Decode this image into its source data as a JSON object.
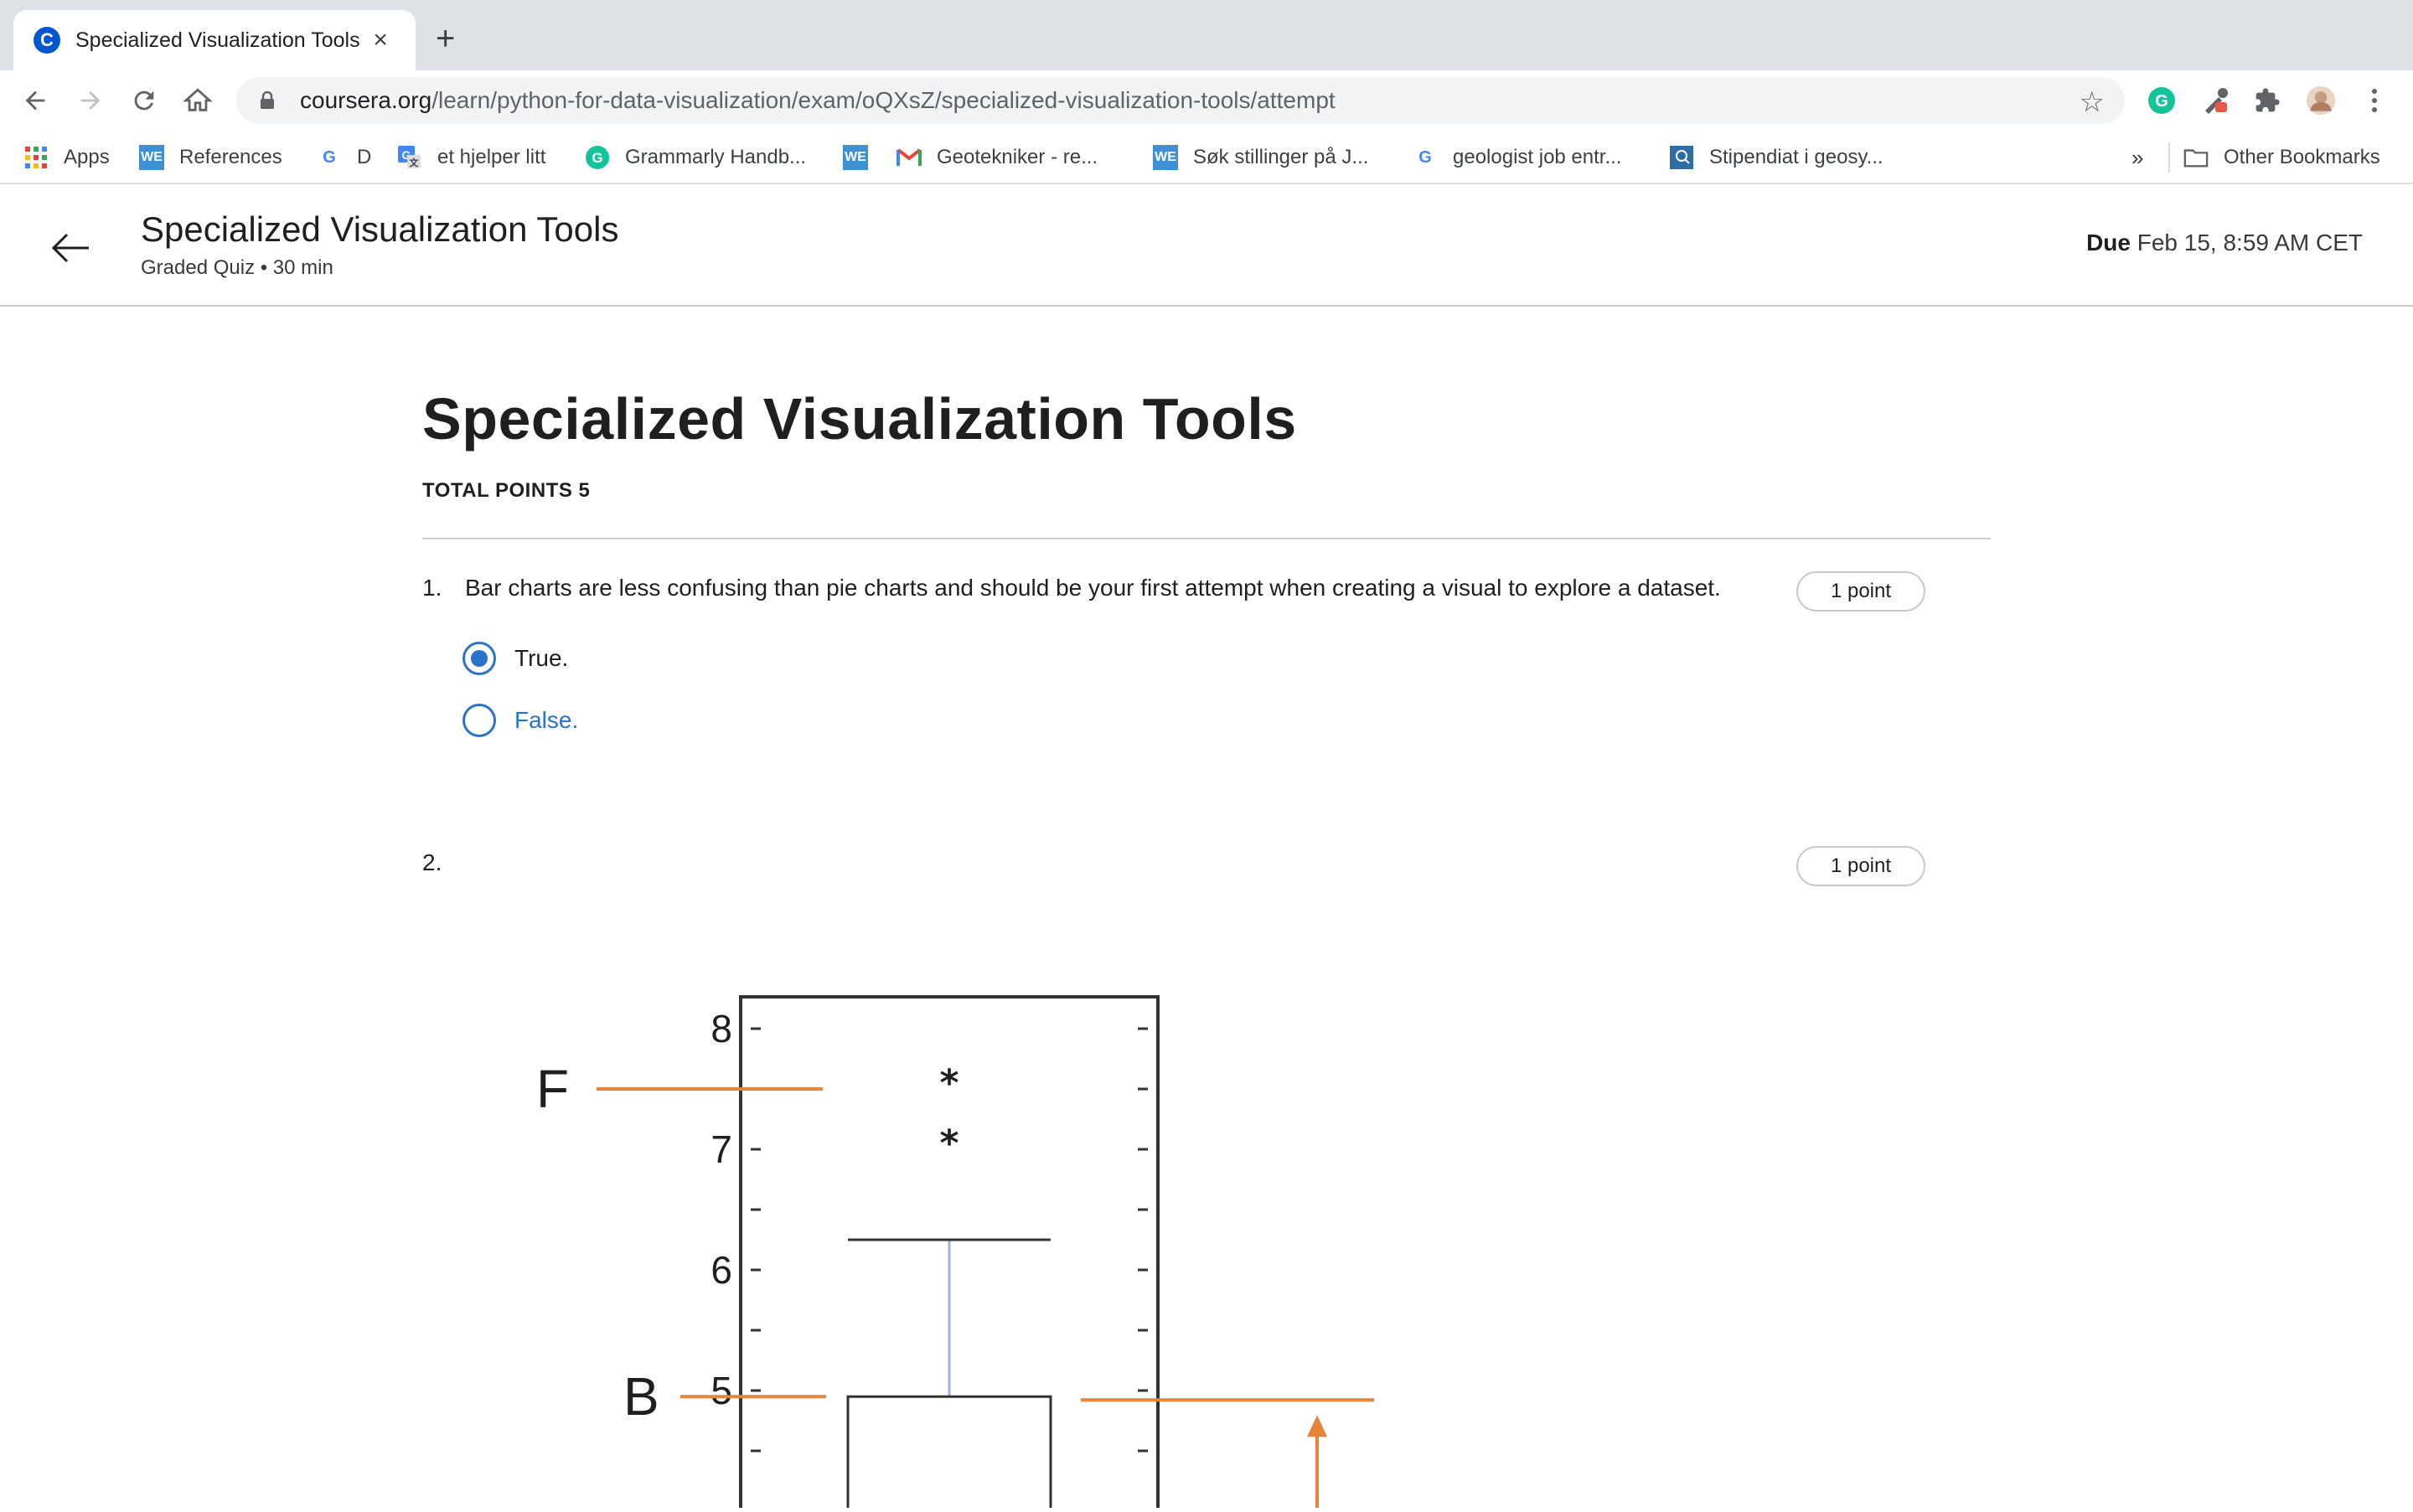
{
  "browser": {
    "tab_title": "Specialized Visualization Tools",
    "tab_favicon_letter": "C",
    "url_domain": "coursera.org",
    "url_path": "/learn/python-for-data-visualization/exam/oQXsZ/specialized-visualization-tools/attempt",
    "bookmarks": [
      {
        "label": "Apps",
        "icon": "apps-grid-icon"
      },
      {
        "label": "References",
        "icon": "we-icon"
      },
      {
        "label": "D",
        "icon": "google-icon"
      },
      {
        "label": "et hjelper litt",
        "icon": "google-translate-icon"
      },
      {
        "label": "Grammarly Handb...",
        "icon": "grammarly-icon"
      },
      {
        "label": "",
        "icon": "we-icon"
      },
      {
        "label": "Geotekniker - re...",
        "icon": "gmail-icon"
      },
      {
        "label": "Søk stillinger på J...",
        "icon": "we-icon"
      },
      {
        "label": "geologist job entr...",
        "icon": "google-icon"
      },
      {
        "label": "Stipendiat i geosy...",
        "icon": "site-icon"
      }
    ],
    "overflow_label": "»",
    "other_bookmarks": "Other Bookmarks"
  },
  "header": {
    "title": "Specialized Visualization Tools",
    "subtitle": "Graded Quiz • 30 min",
    "due_label": "Due",
    "due_value": "Feb 15, 8:59 AM CET"
  },
  "quiz": {
    "title": "Specialized Visualization Tools",
    "total_points": "TOTAL POINTS 5",
    "questions": [
      {
        "number": "1.",
        "text": "Bar charts are less confusing than pie charts and should be your first attempt when creating a visual to explore a dataset.",
        "points": "1 point",
        "options": [
          {
            "label": "True.",
            "selected": true
          },
          {
            "label": "False.",
            "selected": false
          }
        ]
      },
      {
        "number": "2.",
        "text": "",
        "points": "1 point"
      }
    ]
  },
  "chart_data": {
    "type": "boxplot",
    "y_tick_labels": [
      "5",
      "6",
      "7",
      "8"
    ],
    "ylim": [
      4,
      8.2
    ],
    "box": {
      "q3": 4.95,
      "upper_whisker": 6.25
    },
    "outliers": [
      7.1,
      7.6
    ],
    "annotations": [
      {
        "label": "F",
        "y": 7.5
      },
      {
        "label": "B",
        "y": 4.95
      }
    ],
    "colors": {
      "annotation": "#e8833a",
      "whisker": "#9ab3e0",
      "frame": "#333333"
    }
  }
}
